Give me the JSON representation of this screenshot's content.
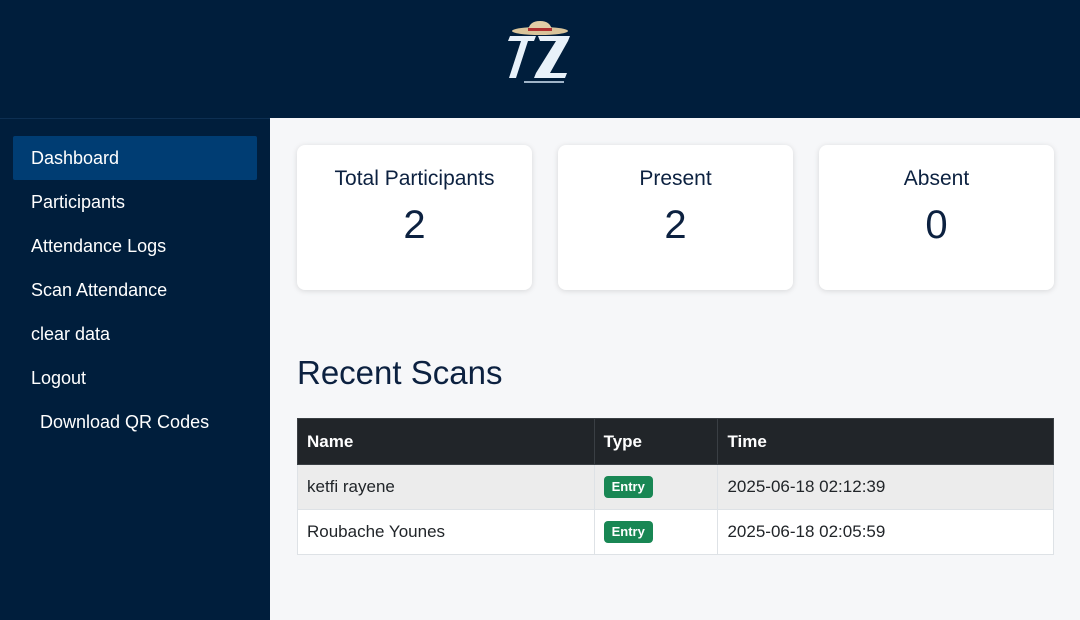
{
  "colors": {
    "header_bg": "#001e3c",
    "sidebar_active": "#003d73",
    "table_header_bg": "#212529",
    "badge_entry": "#198754"
  },
  "logo": {
    "icon": "tz-logo-with-straw-hat"
  },
  "sidebar": {
    "items": [
      {
        "label": "Dashboard",
        "active": true
      },
      {
        "label": "Participants"
      },
      {
        "label": "Attendance Logs"
      },
      {
        "label": "Scan Attendance"
      },
      {
        "label": "clear data"
      },
      {
        "label": "Logout"
      },
      {
        "label": "Download QR Codes"
      }
    ]
  },
  "stats": [
    {
      "title": "Total Participants",
      "value": "2"
    },
    {
      "title": "Present",
      "value": "2"
    },
    {
      "title": "Absent",
      "value": "0"
    }
  ],
  "recent_scans": {
    "title": "Recent Scans",
    "columns": [
      "Name",
      "Type",
      "Time"
    ],
    "rows": [
      {
        "name": "ketfi rayene",
        "type": "Entry",
        "time": "2025-06-18 02:12:39"
      },
      {
        "name": "Roubache Younes",
        "type": "Entry",
        "time": "2025-06-18 02:05:59"
      }
    ]
  }
}
